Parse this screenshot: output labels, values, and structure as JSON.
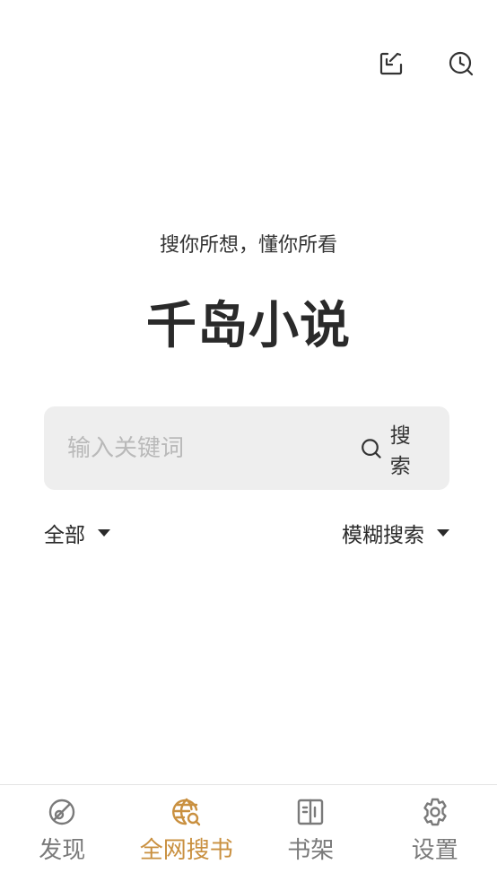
{
  "header": {
    "actions": [
      {
        "icon": "import-icon"
      },
      {
        "icon": "history-icon"
      }
    ]
  },
  "hero": {
    "slogan": "搜你所想，懂你所看",
    "brand": "千岛小说"
  },
  "search": {
    "placeholder": "输入关键词",
    "value": "",
    "button_label": "搜索",
    "button_icon": "search-icon"
  },
  "filters": {
    "scope": "全部",
    "mode": "模糊搜索"
  },
  "tabbar": {
    "items": [
      {
        "label": "发现",
        "icon": "discover-icon",
        "active": false
      },
      {
        "label": "全网搜书",
        "icon": "web-search-icon",
        "active": true
      },
      {
        "label": "书架",
        "icon": "bookshelf-icon",
        "active": false
      },
      {
        "label": "设置",
        "icon": "settings-icon",
        "active": false
      }
    ]
  },
  "colors": {
    "accent": "#c99040",
    "inactive": "#7a7a7a",
    "search_bg": "#eeeeee"
  }
}
